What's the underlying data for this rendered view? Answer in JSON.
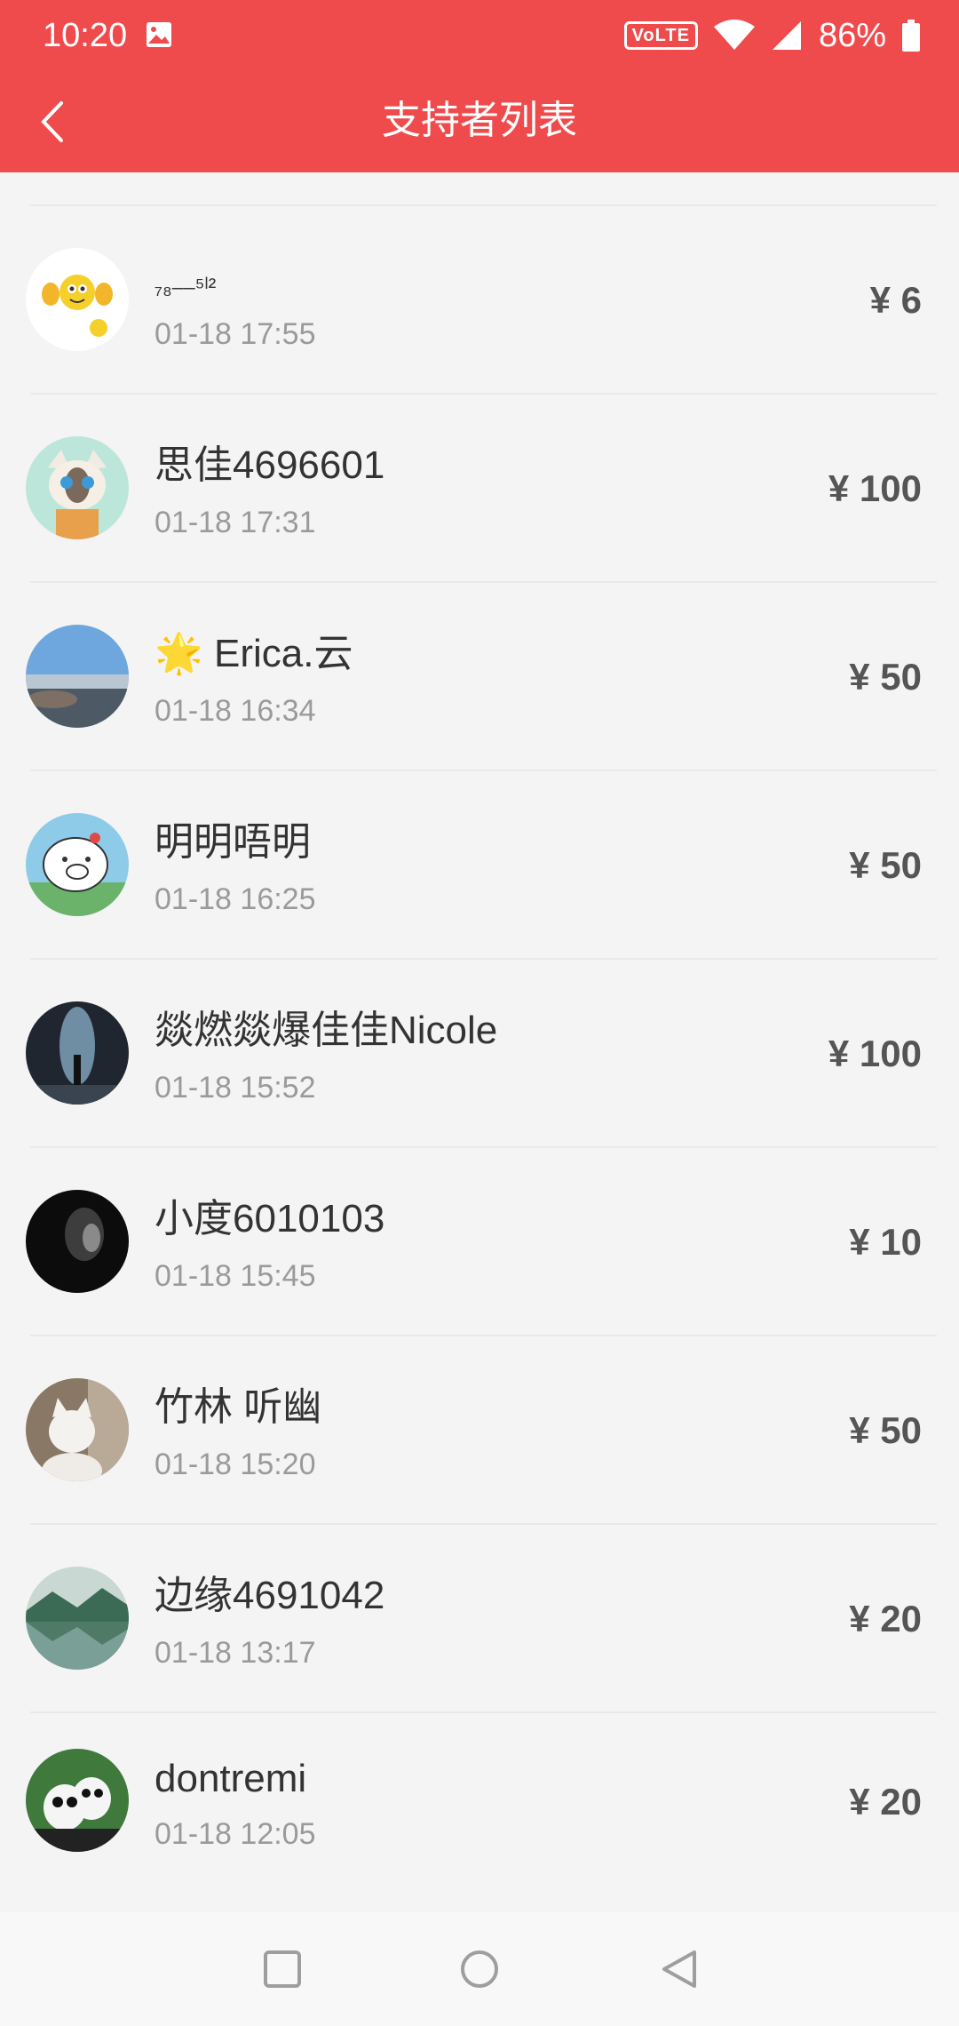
{
  "status_bar": {
    "time": "10:20",
    "network_badge": "VoLTE",
    "battery": "86%",
    "icons": [
      "image-icon",
      "wifi-icon",
      "signal-icon",
      "battery-icon"
    ]
  },
  "header": {
    "title": "支持者列表",
    "back_icon": "chevron-left-icon",
    "background": "#ef4b4d"
  },
  "supporters": [
    {
      "name": "₇₈⎯⎯⁵ˡ²",
      "time": "01-18 17:55",
      "amount": "¥ 6",
      "avatar": "emoji-peace-avatar"
    },
    {
      "name": "思佳4696601",
      "time": "01-18 17:31",
      "amount": "¥ 100",
      "avatar": "cat-cartoon-avatar"
    },
    {
      "name": "🌟 Erica.云",
      "time": "01-18 16:34",
      "amount": "¥ 50",
      "avatar": "seaside-photo-avatar"
    },
    {
      "name": "明明唔明",
      "time": "01-18 16:25",
      "amount": "¥ 50",
      "avatar": "pig-cartoon-avatar"
    },
    {
      "name": "燚燃燚爆佳佳Nicole",
      "time": "01-18 15:52",
      "amount": "¥ 100",
      "avatar": "cave-photo-avatar"
    },
    {
      "name": "小度6010103",
      "time": "01-18 15:45",
      "amount": "¥ 10",
      "avatar": "portrait-dark-avatar"
    },
    {
      "name": "竹林 听幽",
      "time": "01-18 15:20",
      "amount": "¥ 50",
      "avatar": "white-cat-avatar"
    },
    {
      "name": "边缘4691042",
      "time": "01-18 13:17",
      "amount": "¥ 20",
      "avatar": "lake-mountain-avatar"
    },
    {
      "name": "dontremi",
      "time": "01-18 12:05",
      "amount": "¥ 20",
      "avatar": "panda-avatar"
    }
  ],
  "nav_bar": {
    "buttons": [
      "recent-apps-icon",
      "home-icon",
      "back-triangle-icon"
    ]
  }
}
